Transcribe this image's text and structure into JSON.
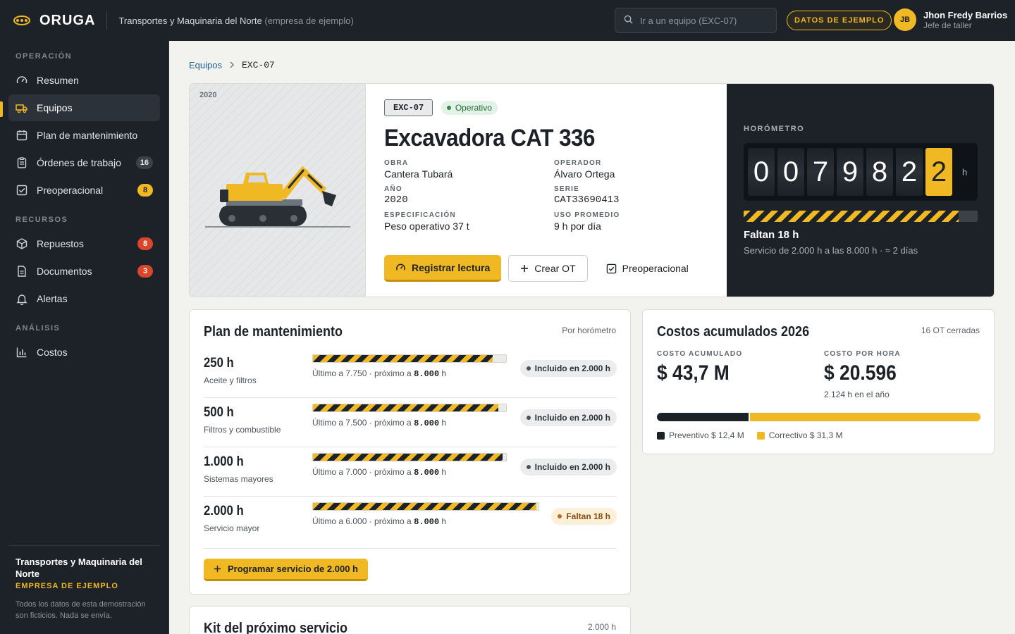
{
  "app": {
    "brand": "ORUGA",
    "company": "Transportes y Maquinaria del Norte",
    "company_note": "(empresa de ejemplo)",
    "search_placeholder": "Ir a un equipo (EXC-07)",
    "demo_label": "DATOS DE EJEMPLO",
    "user": {
      "initials": "JB",
      "name": "Jhon Fredy Barrios",
      "role": "Jefe de taller"
    },
    "colors": {
      "accent": "#f0b823",
      "dark": "#1d2228",
      "danger": "#d9462b",
      "ok": "#2f8a47"
    }
  },
  "sidebar": {
    "sections": [
      "OPERACIÓN",
      "RECURSOS",
      "ANÁLISIS"
    ],
    "items": [
      {
        "label": "Resumen",
        "icon": "gauge-icon"
      },
      {
        "label": "Equipos",
        "icon": "truck-icon",
        "active": true
      },
      {
        "label": "Plan de mantenimiento",
        "icon": "calendar-icon"
      },
      {
        "label": "Órdenes de trabajo",
        "icon": "clipboard-icon",
        "badge": "16"
      },
      {
        "label": "Preoperacional",
        "icon": "checkbox-icon",
        "badge": "8"
      },
      {
        "label": "Repuestos",
        "icon": "box-icon",
        "badge": "8"
      },
      {
        "label": "Documentos",
        "icon": "document-icon",
        "badge": "3"
      },
      {
        "label": "Alertas",
        "icon": "bell-icon"
      },
      {
        "label": "Costos",
        "icon": "bar-chart-icon"
      }
    ],
    "footer": {
      "company": "Transportes y Maquinaria del Norte",
      "tag": "EMPRESA DE EJEMPLO",
      "note": "Todos los datos de esta demostración son ficticios. Nada se envía."
    }
  },
  "breadcrumb": {
    "parent": "Equipos",
    "current": "EXC-07"
  },
  "equipment": {
    "year_tag": "2020",
    "code": "EXC-07",
    "status": "Operativo",
    "title": "Excavadora CAT 336",
    "specs": [
      {
        "label": "OBRA",
        "value": "Cantera Tubará"
      },
      {
        "label": "OPERADOR",
        "value": "Álvaro Ortega"
      },
      {
        "label": "AÑO",
        "value": "2020"
      },
      {
        "label": "SERIE",
        "value": "CAT33690413"
      },
      {
        "label": "ESPECIFICACIÓN",
        "value": "Peso operativo 37 t"
      },
      {
        "label": "USO PROMEDIO",
        "value": "9 h por día"
      }
    ],
    "actions": {
      "register": "Registrar lectura",
      "create_ot": "Crear OT",
      "preop": "Preoperacional"
    }
  },
  "hourmeter": {
    "label": "HORÓMETRO",
    "digits": [
      "0",
      "0",
      "7",
      "9",
      "8",
      "2",
      "2"
    ],
    "unit": "h",
    "progress_pct": 92,
    "remaining": "Faltan 18 h",
    "note": "Servicio de 2.000 h a las 8.000 h · ≈ 2 días"
  },
  "plan": {
    "title": "Plan de mantenimiento",
    "meta": "Por horómetro",
    "rows": [
      {
        "hours": "250 h",
        "name": "Aceite y filtros",
        "last": "Último a 7.750 · próximo a ",
        "next": "8.000",
        "unit": " h",
        "progress_pct": 93,
        "chip": "Incluido en 2.000 h"
      },
      {
        "hours": "500 h",
        "name": "Filtros y combustible",
        "last": "Último a 7.500 · próximo a ",
        "next": "8.000",
        "unit": " h",
        "progress_pct": 96,
        "chip": "Incluido en 2.000 h"
      },
      {
        "hours": "1.000 h",
        "name": "Sistemas mayores",
        "last": "Último a 7.000 · próximo a ",
        "next": "8.000",
        "unit": " h",
        "progress_pct": 98,
        "chip": "Incluido en 2.000 h"
      },
      {
        "hours": "2.000 h",
        "name": "Servicio mayor",
        "last": "Último a 6.000 · próximo a ",
        "next": "8.000",
        "unit": " h",
        "progress_pct": 99,
        "chip": "Faltan 18 h"
      }
    ],
    "cta": "Programar servicio de 2.000 h"
  },
  "costs": {
    "title": "Costos acumulados 2026",
    "meta": "16 OT cerradas",
    "total_label": "COSTO ACUMULADO",
    "total_value": "$ 43,7 M",
    "per_hour_label": "COSTO POR HORA",
    "per_hour_value": "$ 20.596",
    "per_hour_sub": "2.124 h en el año",
    "preventive_m": 12.4,
    "corrective_m": 31.3,
    "legend_prev": "Preventivo $ 12,4 M",
    "legend_corr": "Correctivo $ 31,3 M"
  },
  "kit": {
    "title": "Kit del próximo servicio",
    "meta": "2.000 h"
  }
}
